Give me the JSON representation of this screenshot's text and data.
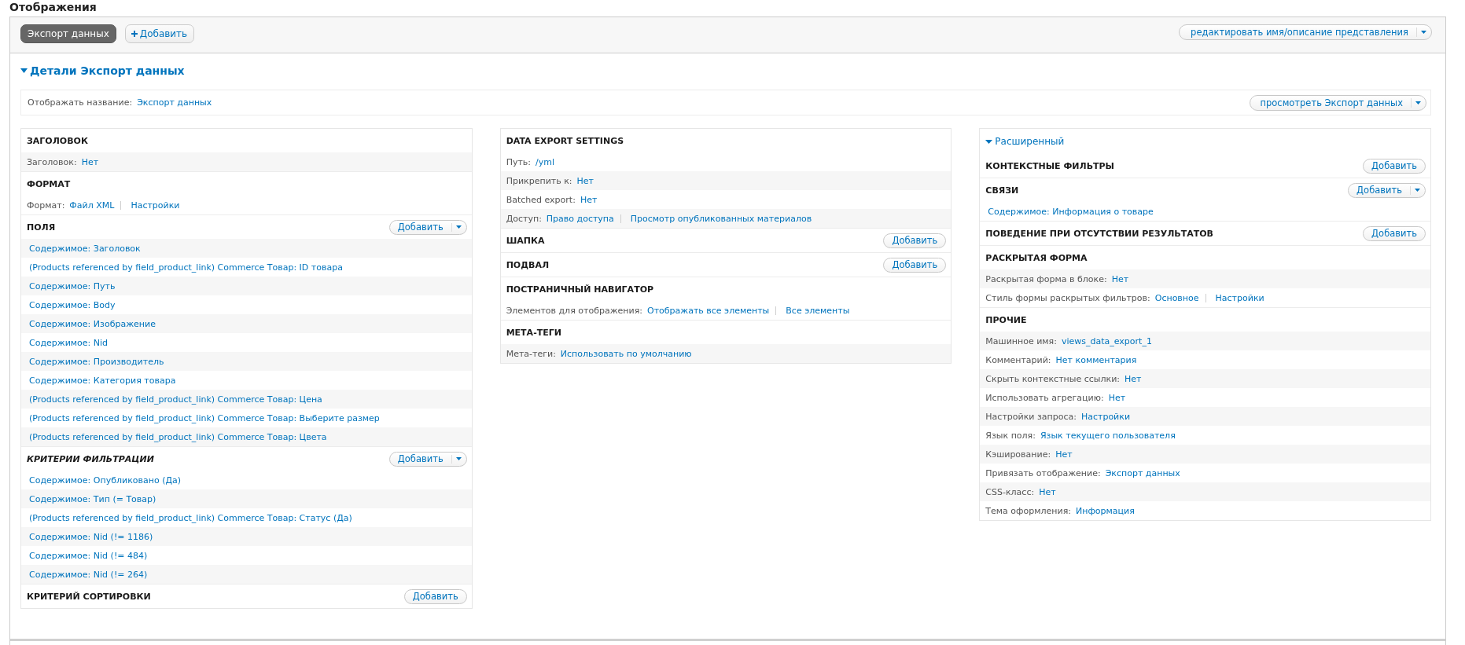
{
  "page_title": "Отображения",
  "display_tabs": [
    {
      "label": "Экспорт данных",
      "selected": true
    }
  ],
  "add_display_button": {
    "label": "Добавить"
  },
  "edit_view_dropbutton": {
    "label": "редактировать имя/описание представления"
  },
  "details": {
    "title": "Детали Экспорт данных",
    "expanded": true
  },
  "display_name": {
    "label": "Отображать название:",
    "value": "Экспорт данных"
  },
  "view_dropbutton": {
    "label": "просмотреть Экспорт данных"
  },
  "columns": [
    {
      "sections": [
        {
          "title": "ЗАГОЛОВОК",
          "italic": false,
          "rows": [
            {
              "label": "Заголовок:",
              "values": [
                "Нет"
              ],
              "shaded": true
            }
          ]
        },
        {
          "title": "ФОРМАТ",
          "italic": false,
          "rows": [
            {
              "label": "Формат:",
              "values": [
                "Файл XML",
                "Настройки"
              ],
              "shaded": false
            }
          ]
        },
        {
          "title": "ПОЛЯ",
          "italic": false,
          "add_button": {
            "label": "Добавить",
            "dropdown": true
          },
          "rows": [
            {
              "values": [
                "Содержимое: Заголовок"
              ],
              "shaded": true
            },
            {
              "values": [
                "(Products referenced by field_product_link) Commerce Товар: ID товара"
              ],
              "shaded": false
            },
            {
              "values": [
                "Содержимое: Путь"
              ],
              "shaded": true
            },
            {
              "values": [
                "Содержимое: Body"
              ],
              "shaded": false
            },
            {
              "values": [
                "Содержимое: Изображение"
              ],
              "shaded": true
            },
            {
              "values": [
                "Содержимое: Nid"
              ],
              "shaded": false
            },
            {
              "values": [
                "Содержимое: Производитель"
              ],
              "shaded": true
            },
            {
              "values": [
                "Содержимое: Категория товара"
              ],
              "shaded": false
            },
            {
              "values": [
                "(Products referenced by field_product_link) Commerce Товар: Цена"
              ],
              "shaded": true
            },
            {
              "values": [
                "(Products referenced by field_product_link) Commerce Товар: Выберите размер"
              ],
              "shaded": false
            },
            {
              "values": [
                "(Products referenced by field_product_link) Commerce Товар: Цвета"
              ],
              "shaded": true
            }
          ]
        },
        {
          "title": "КРИТЕРИИ ФИЛЬТРАЦИИ",
          "italic": true,
          "add_button": {
            "label": "Добавить",
            "dropdown": true
          },
          "rows": [
            {
              "values": [
                "Содержимое: Опубликовано (Да)"
              ],
              "shaded": false
            },
            {
              "values": [
                "Содержимое: Тип (= Товар)"
              ],
              "shaded": true
            },
            {
              "values": [
                "(Products referenced by field_product_link) Commerce Товар: Статус (Да)"
              ],
              "shaded": false
            },
            {
              "values": [
                "Содержимое: Nid (!= 1186)"
              ],
              "shaded": true
            },
            {
              "values": [
                "Содержимое: Nid (!= 484)"
              ],
              "shaded": false
            },
            {
              "values": [
                "Содержимое: Nid (!= 264)"
              ],
              "shaded": true
            }
          ]
        },
        {
          "title": "КРИТЕРИЙ СОРТИРОВКИ",
          "italic": false,
          "add_button": {
            "label": "Добавить",
            "dropdown": false
          }
        }
      ]
    },
    {
      "sections": [
        {
          "title": "DATA EXPORT SETTINGS",
          "italic": false,
          "rows": [
            {
              "label": "Путь:",
              "values": [
                "/yml"
              ],
              "shaded": false
            },
            {
              "label": "Прикрепить к:",
              "values": [
                "Нет"
              ],
              "shaded": true
            },
            {
              "label": "Batched export:",
              "values": [
                "Нет"
              ],
              "shaded": false
            },
            {
              "label": "Доступ:",
              "values": [
                "Право доступа",
                "Просмотр опубликованных материалов"
              ],
              "shaded": true
            }
          ]
        },
        {
          "title": "ШАПКА",
          "italic": false,
          "add_button": {
            "label": "Добавить",
            "dropdown": false
          }
        },
        {
          "title": "ПОДВАЛ",
          "italic": false,
          "add_button": {
            "label": "Добавить",
            "dropdown": false
          }
        },
        {
          "title": "ПОСТРАНИЧНЫЙ НАВИГАТОР",
          "italic": false,
          "rows": [
            {
              "label": "Элементов для отображения:",
              "values": [
                "Отображать все элементы",
                "Все элементы"
              ],
              "shaded": false
            }
          ]
        },
        {
          "title": "МЕТА-ТЕГИ",
          "italic": false,
          "rows": [
            {
              "label": "Мета-теги:",
              "values": [
                "Использовать по умолчанию"
              ],
              "shaded": true
            }
          ]
        }
      ]
    },
    {
      "advanced": {
        "title": "Расширенный",
        "expanded": true
      },
      "sections": [
        {
          "title": "КОНТЕКСТНЫЕ ФИЛЬТРЫ",
          "italic": false,
          "add_button": {
            "label": "Добавить",
            "dropdown": false
          }
        },
        {
          "title": "СВЯЗИ",
          "italic": false,
          "add_button": {
            "label": "Добавить",
            "dropdown": true
          },
          "rows": [
            {
              "values": [
                "Содержимое: Информация о товаре"
              ],
              "shaded": false
            }
          ]
        },
        {
          "title": "ПОВЕДЕНИЕ ПРИ ОТСУТСТВИИ РЕЗУЛЬТАТОВ",
          "italic": false,
          "add_button": {
            "label": "Добавить",
            "dropdown": false
          }
        },
        {
          "title": "РАСКРЫТАЯ ФОРМА",
          "italic": false,
          "rows": [
            {
              "label": "Раскрытая форма в блоке:",
              "values": [
                "Нет"
              ],
              "shaded": true
            },
            {
              "label": "Стиль формы раскрытых фильтров:",
              "values": [
                "Основное",
                "Настройки"
              ],
              "shaded": false
            }
          ]
        },
        {
          "title": "ПРОЧИЕ",
          "italic": false,
          "rows": [
            {
              "label": "Машинное имя:",
              "values": [
                "views_data_export_1"
              ],
              "shaded": true
            },
            {
              "label": "Комментарий:",
              "values": [
                "Нет комментария"
              ],
              "shaded": false
            },
            {
              "label": "Скрыть контекстные ссылки:",
              "values": [
                "Нет"
              ],
              "shaded": true
            },
            {
              "label": "Использовать агрегацию:",
              "values": [
                "Нет"
              ],
              "shaded": false
            },
            {
              "label": "Настройки запроса:",
              "values": [
                "Настройки"
              ],
              "shaded": true
            },
            {
              "label": "Язык поля:",
              "values": [
                "Язык текущего пользователя"
              ],
              "shaded": false
            },
            {
              "label": "Кэширование:",
              "values": [
                "Нет"
              ],
              "shaded": true
            },
            {
              "label": "Привязать отображение:",
              "values": [
                "Экспорт данных"
              ],
              "shaded": false
            },
            {
              "label": "CSS-класс:",
              "values": [
                "Нет"
              ],
              "shaded": true
            },
            {
              "label": "Тема оформления:",
              "values": [
                "Информация"
              ],
              "shaded": false
            }
          ]
        }
      ]
    }
  ]
}
